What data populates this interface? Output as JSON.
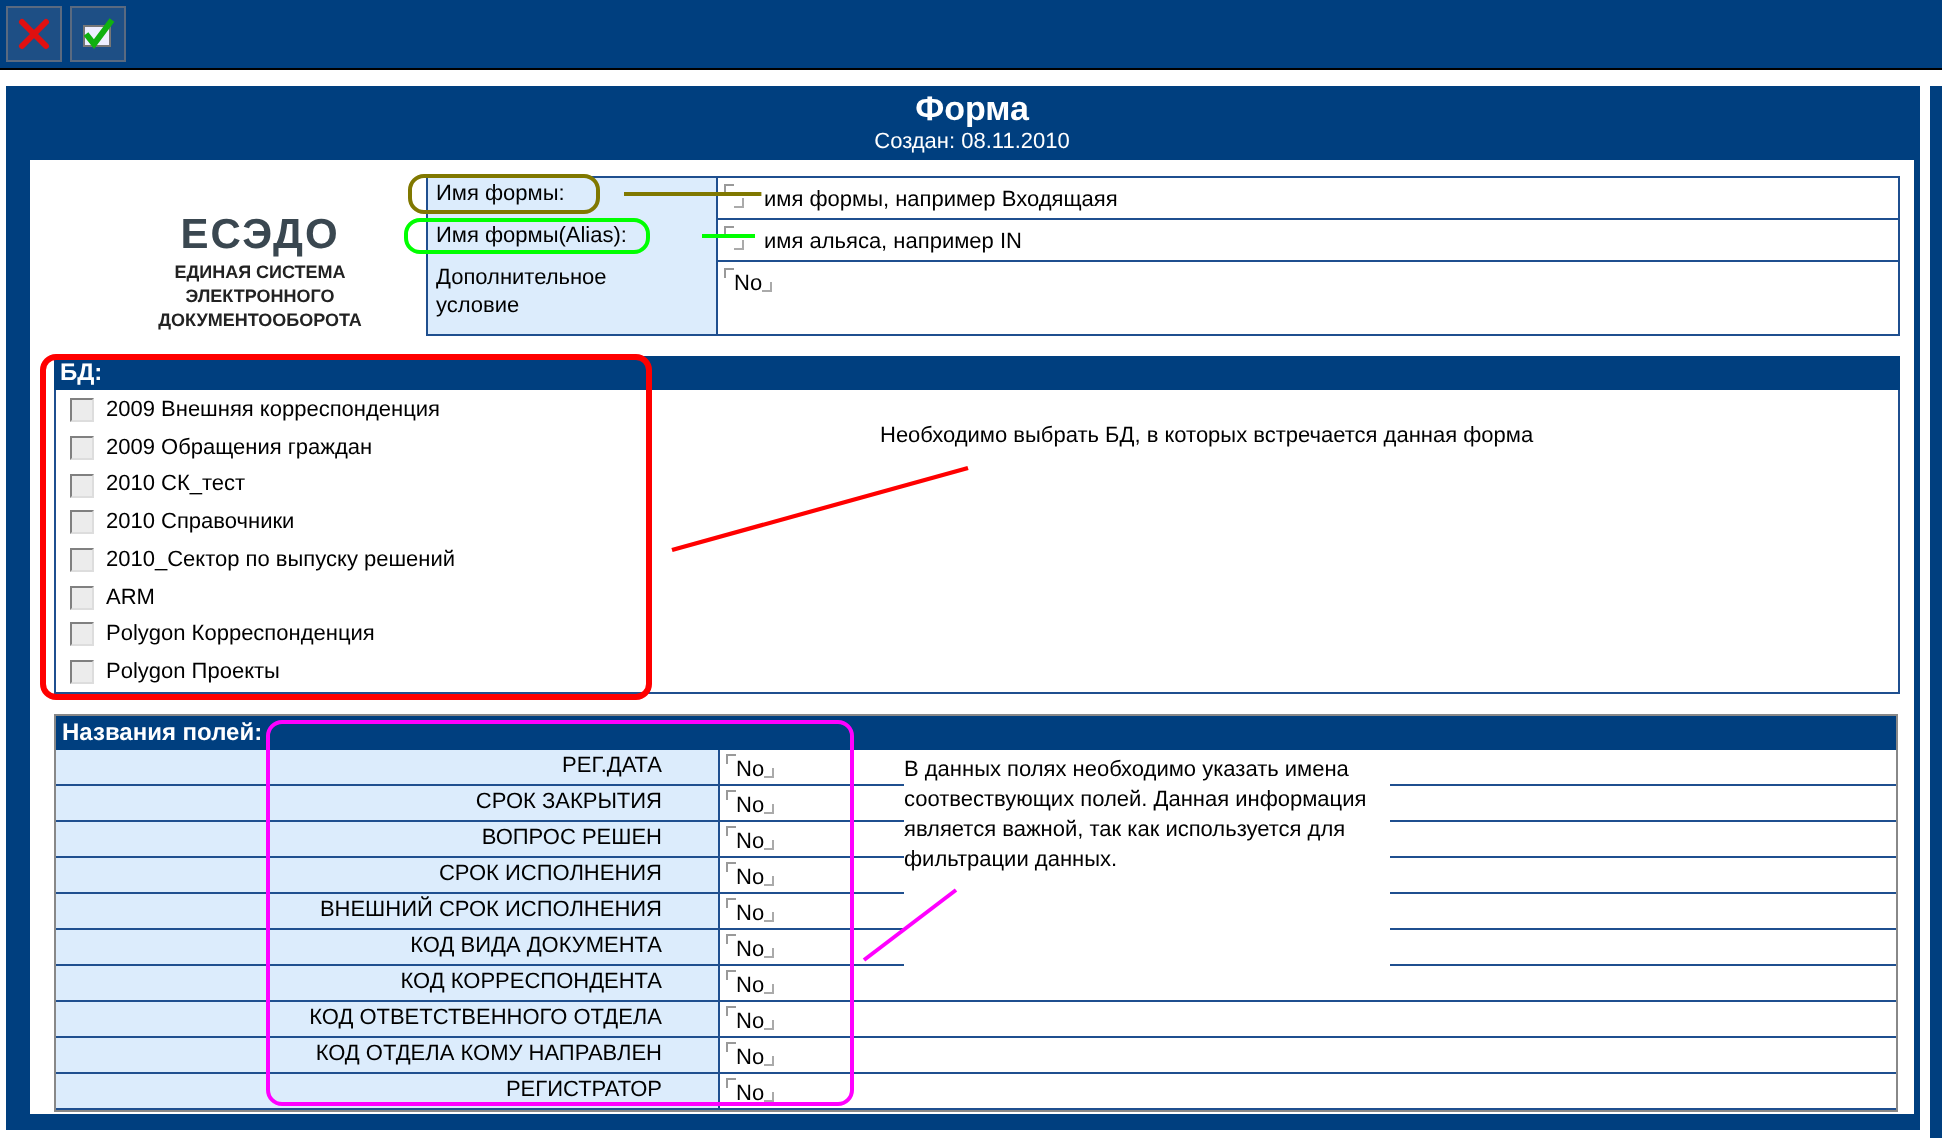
{
  "toolbar": {
    "buttons": [
      {
        "kind": "cancel"
      },
      {
        "kind": "apply"
      }
    ]
  },
  "header": {
    "title": "Форма",
    "created": "Создан: 08.11.2010"
  },
  "logo": {
    "title": "ЕСЭДО",
    "subtitle_lines": [
      "ЕДИНАЯ СИСТЕМА",
      "ЭЛЕКТРОННОГО",
      "ДОКУМЕНТООБОРОТА"
    ]
  },
  "form_properties": [
    {
      "label": "Имя формы:",
      "hint": "имя формы, например Входящаяя"
    },
    {
      "label": "Имя формы(Alias):",
      "hint": "имя альяса, например IN"
    },
    {
      "label": "Дополнительное условие",
      "value": "No"
    }
  ],
  "databases": {
    "title": "БД:",
    "hint": "Необходимо выбрать БД, в которых встречается данная форма",
    "items": [
      {
        "label": "2009 Внешняя корреспонденция",
        "checked": false
      },
      {
        "label": "2009 Обращения граждан",
        "checked": false
      },
      {
        "label": "2010 СК_тест",
        "checked": false
      },
      {
        "label": "2010 Справочники",
        "checked": false
      },
      {
        "label": "2010_Сектор по выпуску решений",
        "checked": false
      },
      {
        "label": "ARM",
        "checked": false
      },
      {
        "label": "Polygon Корреспонденция",
        "checked": false
      },
      {
        "label": "Polygon Проекты",
        "checked": false
      }
    ]
  },
  "field_names": {
    "title": "Названия полей:",
    "hint": "В данных полях необходимо указать имена соотвествующих полей. Данная информация является важной, так как используется для фильтрации данных.",
    "rows": [
      {
        "label": "РЕГ.ДАТА",
        "value": "No"
      },
      {
        "label": "СРОК ЗАКРЫТИЯ",
        "value": "No"
      },
      {
        "label": "ВОПРОС РЕШЕН",
        "value": "No"
      },
      {
        "label": "СРОК ИСПОЛНЕНИЯ",
        "value": "No"
      },
      {
        "label": "ВНЕШНИЙ СРОК ИСПОЛНЕНИЯ",
        "value": "No"
      },
      {
        "label": "КОД ВИДА ДОКУМЕНТА",
        "value": "No"
      },
      {
        "label": "КОД КОРРЕСПОНДЕНТА",
        "value": "No"
      },
      {
        "label": "КОД ОТВЕТСТВЕННОГО ОТДЕЛА",
        "value": "No"
      },
      {
        "label": "КОД ОТДЕЛА КОМУ НАПРАВЛЕН",
        "value": "No"
      },
      {
        "label": "РЕГИСТРАТОР",
        "value": "No"
      }
    ]
  },
  "annotations": [
    {
      "kind": "outline",
      "color": "#807800"
    },
    {
      "kind": "line",
      "color": "#807800"
    },
    {
      "kind": "outline",
      "color": "#00ff00"
    },
    {
      "kind": "line",
      "color": "#00ff00"
    },
    {
      "kind": "outline",
      "color": "#ff0000"
    },
    {
      "kind": "line",
      "color": "#ff0000"
    },
    {
      "kind": "outline",
      "color": "#ff00ff"
    },
    {
      "kind": "line",
      "color": "#ff00ff"
    }
  ]
}
